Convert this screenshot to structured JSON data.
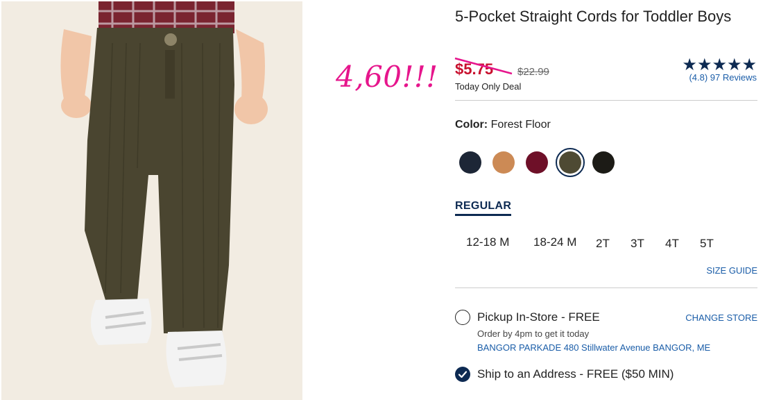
{
  "overlay": {
    "handwritten_price": "4,60!!!"
  },
  "product": {
    "title": "5-Pocket Straight Cords for Toddler Boys",
    "sale_price": "$5.75",
    "original_price": "$22.99",
    "deal_text": "Today Only Deal",
    "rating_stars": "★★★★★",
    "rating_value": "(4.8)",
    "reviews_text": "97 Reviews"
  },
  "color": {
    "label": "Color:",
    "selected": "Forest Floor",
    "swatches": [
      {
        "name": "navy",
        "hex": "#1d2636"
      },
      {
        "name": "tan",
        "hex": "#cc8a55"
      },
      {
        "name": "burgundy",
        "hex": "#6e1028"
      },
      {
        "name": "forest-floor",
        "hex": "#4e4a33",
        "selected": true
      },
      {
        "name": "black",
        "hex": "#1c1b16"
      }
    ]
  },
  "fit": {
    "active_tab": "REGULAR"
  },
  "sizes": [
    "12-18 M",
    "18-24 M",
    "2T",
    "3T",
    "4T",
    "5T"
  ],
  "size_guide": "SIZE GUIDE",
  "fulfillment": {
    "pickup_label": "Pickup In-Store - FREE",
    "change_store": "CHANGE STORE",
    "order_by": "Order by 4pm to get it today",
    "store_address": "BANGOR PARKADE 480 Stillwater Avenue  BANGOR, ME",
    "ship_label": "Ship to an Address - FREE ($50 MIN)"
  },
  "colors": {
    "accent": "#0d2a52",
    "sale": "#c8102e",
    "link": "#1a5da8",
    "overlay": "#e6158c"
  },
  "icons": {
    "radio_checked": "checkmark-icon",
    "rating": "star-icon"
  }
}
